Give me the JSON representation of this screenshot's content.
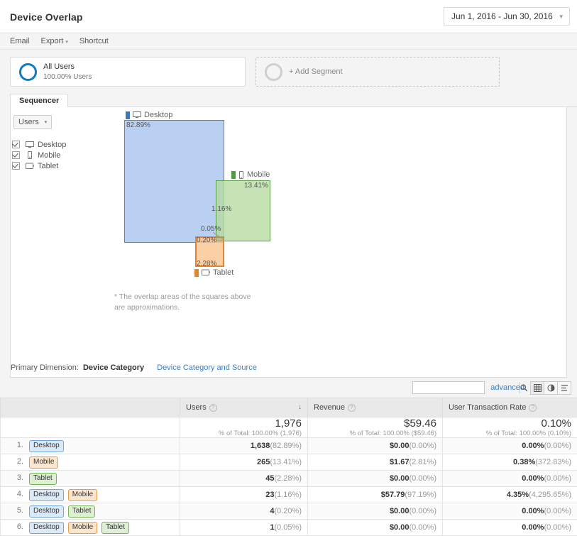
{
  "header": {
    "title": "Device Overlap",
    "date_range": "Jun 1, 2016 - Jun 30, 2016",
    "caret": "▼"
  },
  "actions": {
    "email": "Email",
    "export": "Export",
    "export_caret": "▾",
    "shortcut": "Shortcut"
  },
  "segments": {
    "all_users": {
      "name": "All Users",
      "sub": "100.00% Users"
    },
    "add_segment": "+ Add Segment"
  },
  "tabs": [
    {
      "label": "Sequencer"
    }
  ],
  "metric_selector": {
    "label": "Users",
    "caret": "▾"
  },
  "device_filters": [
    {
      "label": "Desktop",
      "icon": "desktop-icon",
      "checked": true
    },
    {
      "label": "Mobile",
      "icon": "mobile-icon",
      "checked": true
    },
    {
      "label": "Tablet",
      "icon": "tablet-icon",
      "checked": true
    }
  ],
  "venn": {
    "desktop_label": "Desktop",
    "mobile_label": "Mobile",
    "tablet_label": "Tablet",
    "desktop_pct": "82.89%",
    "mobile_pct": "13.41%",
    "tablet_pct": "2.28%",
    "desktop_mobile_pct": "1.16%",
    "desktop_tablet_pct": "0.20%",
    "all_three_pct": "0.05%",
    "colors": {
      "desktop_fill": "#b9d0f2",
      "desktop_stroke": "#4a86d6",
      "mobile_fill": "#c8e3bb",
      "mobile_stroke": "#5aa14a",
      "tablet_fill": "#fbd6ae",
      "tablet_stroke": "#e8832a"
    },
    "footnote": "* The overlap areas of the squares above are approximations."
  },
  "primary_dimension": {
    "label": "Primary Dimension:",
    "active": "Device Category",
    "link": "Device Category and Source"
  },
  "table_tools": {
    "search_placeholder": "",
    "search_value": "",
    "search_icon": "search-icon",
    "advanced": "advanced",
    "view_buttons": [
      "table-view-icon",
      "pie-view-icon",
      "comparison-view-icon"
    ]
  },
  "table": {
    "columns": [
      {
        "label": "",
        "help": false
      },
      {
        "label": "Users",
        "help": true,
        "sorted": true,
        "sort_arrow": "↓"
      },
      {
        "label": "Revenue",
        "help": true
      },
      {
        "label": "User Transaction Rate",
        "help": true
      }
    ],
    "totals": {
      "users": {
        "value": "1,976",
        "sub": "% of Total: 100.00% (1,976)"
      },
      "revenue": {
        "value": "$59.46",
        "sub": "% of Total: 100.00% ($59.46)"
      },
      "rate": {
        "value": "0.10%",
        "sub": "% of Total: 100.00% (0.10%)"
      }
    },
    "rows": [
      {
        "index": "1.",
        "chips": [
          "Desktop"
        ],
        "users": "1,638",
        "users_pct": "(82.89%)",
        "revenue": "$0.00",
        "revenue_pct": "(0.00%)",
        "rate": "0.00%",
        "rate_pct": "(0.00%)"
      },
      {
        "index": "2.",
        "chips": [
          "Mobile"
        ],
        "users": "265",
        "users_pct": "(13.41%)",
        "revenue": "$1.67",
        "revenue_pct": "(2.81%)",
        "rate": "0.38%",
        "rate_pct": "(372.83%)"
      },
      {
        "index": "3.",
        "chips": [
          "Tablet"
        ],
        "users": "45",
        "users_pct": "(2.28%)",
        "revenue": "$0.00",
        "revenue_pct": "(0.00%)",
        "rate": "0.00%",
        "rate_pct": "(0.00%)"
      },
      {
        "index": "4.",
        "chips": [
          "Desktop",
          "Mobile"
        ],
        "users": "23",
        "users_pct": "(1.16%)",
        "revenue": "$57.79",
        "revenue_pct": "(97.19%)",
        "rate": "4.35%",
        "rate_pct": "(4,295.65%)"
      },
      {
        "index": "5.",
        "chips": [
          "Desktop",
          "Tablet"
        ],
        "users": "4",
        "users_pct": "(0.20%)",
        "revenue": "$0.00",
        "revenue_pct": "(0.00%)",
        "rate": "0.00%",
        "rate_pct": "(0.00%)"
      },
      {
        "index": "6.",
        "chips": [
          "Desktop",
          "Mobile",
          "Tablet"
        ],
        "users": "1",
        "users_pct": "(0.05%)",
        "revenue": "$0.00",
        "revenue_pct": "(0.00%)",
        "rate": "0.00%",
        "rate_pct": "(0.00%)"
      }
    ]
  },
  "chart_data": {
    "type": "venn",
    "title": "Device Overlap",
    "metric": "Users",
    "total_users": 1976,
    "sets": [
      {
        "name": "Desktop",
        "exclusive_users": 1638,
        "exclusive_pct": 82.89,
        "color": "#b9d0f2"
      },
      {
        "name": "Mobile",
        "exclusive_users": 265,
        "exclusive_pct": 13.41,
        "color": "#c8e3bb"
      },
      {
        "name": "Tablet",
        "exclusive_users": 45,
        "exclusive_pct": 2.28,
        "color": "#fbd6ae"
      }
    ],
    "intersections": [
      {
        "sets": [
          "Desktop",
          "Mobile"
        ],
        "users": 23,
        "pct": 1.16
      },
      {
        "sets": [
          "Desktop",
          "Tablet"
        ],
        "users": 4,
        "pct": 0.2
      },
      {
        "sets": [
          "Desktop",
          "Mobile",
          "Tablet"
        ],
        "users": 1,
        "pct": 0.05
      }
    ]
  }
}
